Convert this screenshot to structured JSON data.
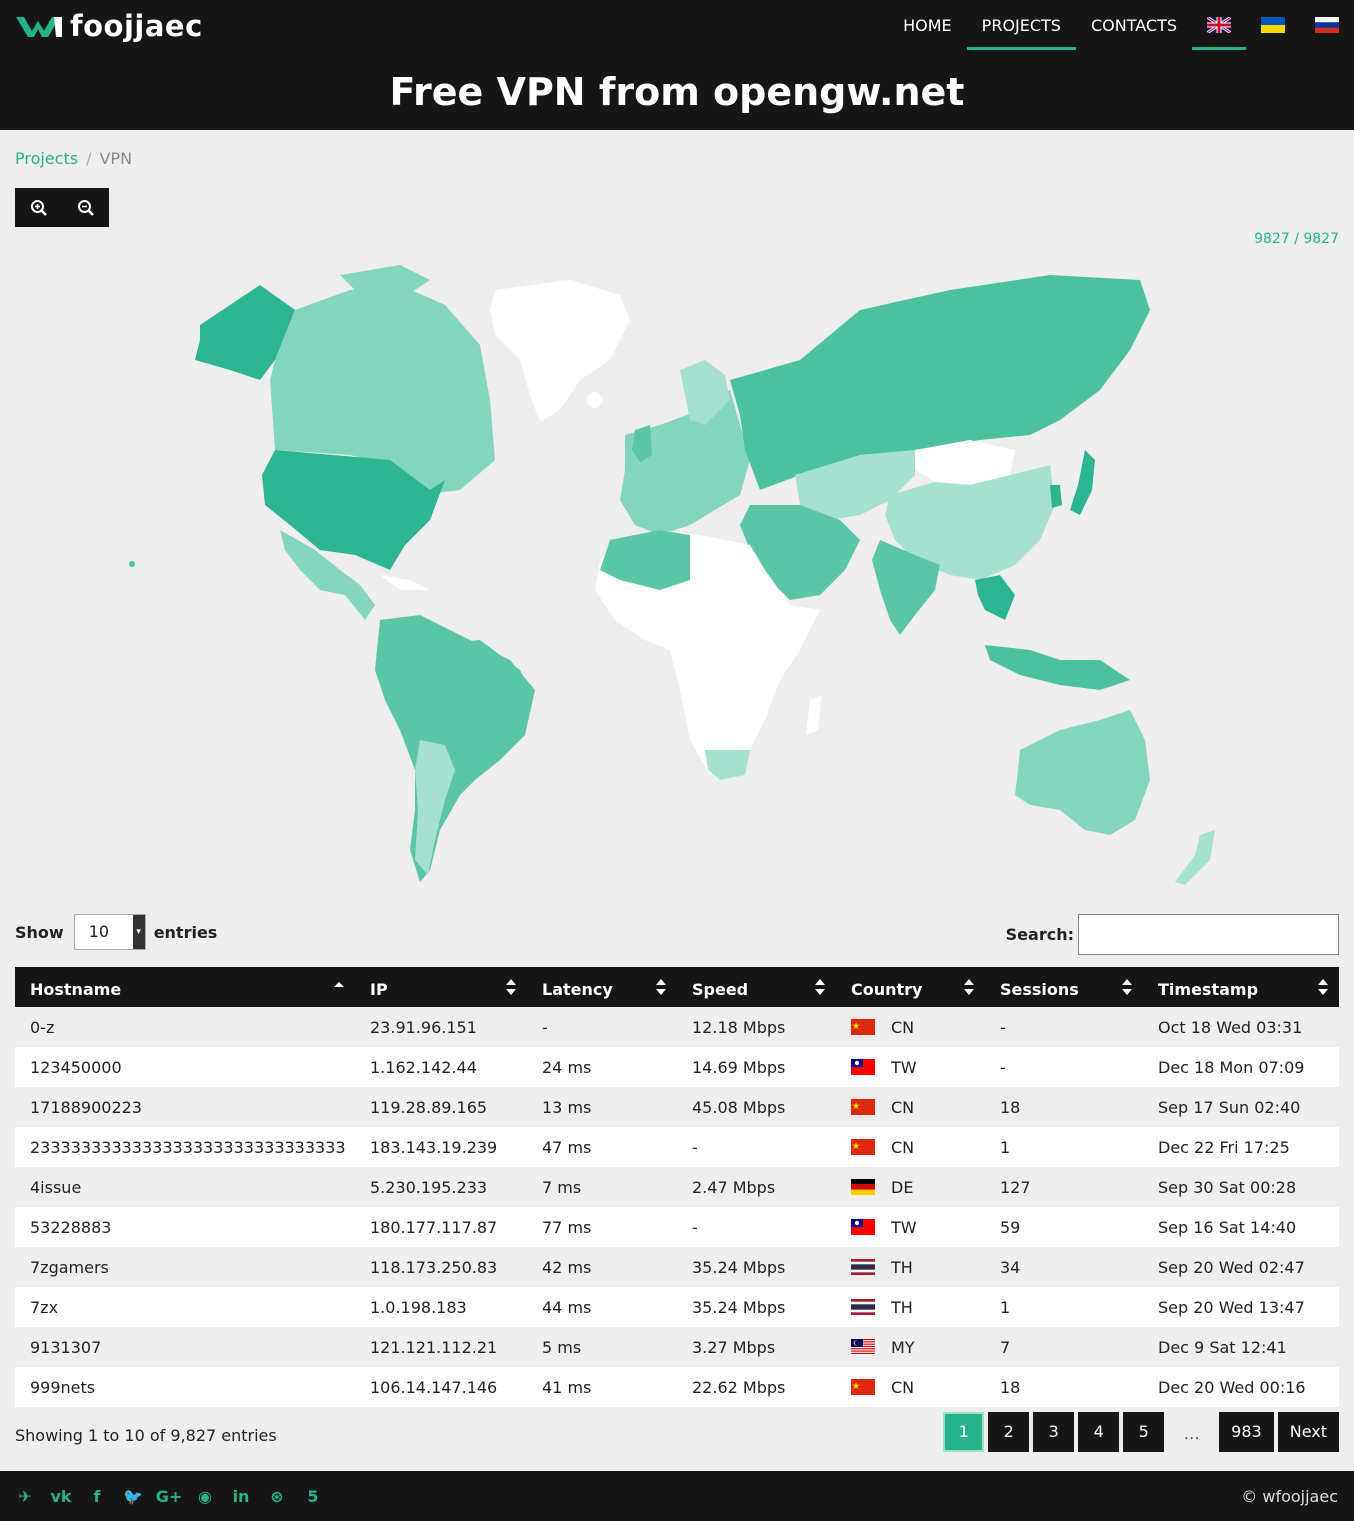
{
  "brand": {
    "name": "foojjaec"
  },
  "nav": {
    "items": [
      "HOME",
      "PROJECTS",
      "CONTACTS"
    ],
    "active": "PROJECTS",
    "languages": [
      "en-flag-icon",
      "ua-flag-icon",
      "ru-flag-icon"
    ]
  },
  "page": {
    "title": "Free VPN from opengw.net"
  },
  "breadcrumb": {
    "link": "Projects",
    "current": "VPN"
  },
  "toolbar": {
    "zoom_in_icon": "zoom-in-icon",
    "zoom_out_icon": "zoom-out-icon"
  },
  "map": {
    "counter": "9827 / 9827",
    "accent": "#24b38b"
  },
  "table_controls": {
    "show_label": "Show",
    "entries_value": "10",
    "entries_label": "entries",
    "search_label": "Search:",
    "search_value": ""
  },
  "table": {
    "columns": [
      "Hostname",
      "IP",
      "Latency",
      "Speed",
      "Country",
      "Sessions",
      "Timestamp"
    ],
    "rows": [
      {
        "hostname": "0-z",
        "ip": "23.91.96.151",
        "latency": "-",
        "speed": "12.18 Mbps",
        "country": "CN",
        "sessions": "-",
        "timestamp": "Oct 18 Wed 03:31"
      },
      {
        "hostname": "123450000",
        "ip": "1.162.142.44",
        "latency": "24 ms",
        "speed": "14.69 Mbps",
        "country": "TW",
        "sessions": "-",
        "timestamp": "Dec 18 Mon 07:09"
      },
      {
        "hostname": "17188900223",
        "ip": "119.28.89.165",
        "latency": "13 ms",
        "speed": "45.08 Mbps",
        "country": "CN",
        "sessions": "18",
        "timestamp": "Sep 17 Sun 02:40"
      },
      {
        "hostname": "2333333333333333333333333333333",
        "ip": "183.143.19.239",
        "latency": "47 ms",
        "speed": "-",
        "country": "CN",
        "sessions": "1",
        "timestamp": "Dec 22 Fri 17:25"
      },
      {
        "hostname": "4issue",
        "ip": "5.230.195.233",
        "latency": "7 ms",
        "speed": "2.47 Mbps",
        "country": "DE",
        "sessions": "127",
        "timestamp": "Sep 30 Sat 00:28"
      },
      {
        "hostname": "53228883",
        "ip": "180.177.117.87",
        "latency": "77 ms",
        "speed": "-",
        "country": "TW",
        "sessions": "59",
        "timestamp": "Sep 16 Sat 14:40"
      },
      {
        "hostname": "7zgamers",
        "ip": "118.173.250.83",
        "latency": "42 ms",
        "speed": "35.24 Mbps",
        "country": "TH",
        "sessions": "34",
        "timestamp": "Sep 20 Wed 02:47"
      },
      {
        "hostname": "7zx",
        "ip": "1.0.198.183",
        "latency": "44 ms",
        "speed": "35.24 Mbps",
        "country": "TH",
        "sessions": "1",
        "timestamp": "Sep 20 Wed 13:47"
      },
      {
        "hostname": "9131307",
        "ip": "121.121.112.21",
        "latency": "5 ms",
        "speed": "3.27 Mbps",
        "country": "MY",
        "sessions": "7",
        "timestamp": "Dec 9 Sat 12:41"
      },
      {
        "hostname": "999nets",
        "ip": "106.14.147.146",
        "latency": "41 ms",
        "speed": "22.62 Mbps",
        "country": "CN",
        "sessions": "18",
        "timestamp": "Dec 20 Wed 00:16"
      }
    ]
  },
  "pagination": {
    "info": "Showing 1 to 10 of 9,827 entries",
    "pages": [
      "1",
      "2",
      "3",
      "4",
      "5"
    ],
    "current": "1",
    "ellipsis": "…",
    "last": "983",
    "next": "Next"
  },
  "footer": {
    "social_icons": [
      "telegram-icon",
      "vk-icon",
      "facebook-icon",
      "twitter-icon",
      "google-plus-icon",
      "github-icon",
      "linkedin-icon",
      "dribbble-icon",
      "500px-icon"
    ],
    "social_glyphs": [
      "✈",
      "vk",
      "f",
      "🐦",
      "G+",
      "◉",
      "in",
      "⊛",
      "5"
    ],
    "copyright": "© wfoojjaec"
  }
}
